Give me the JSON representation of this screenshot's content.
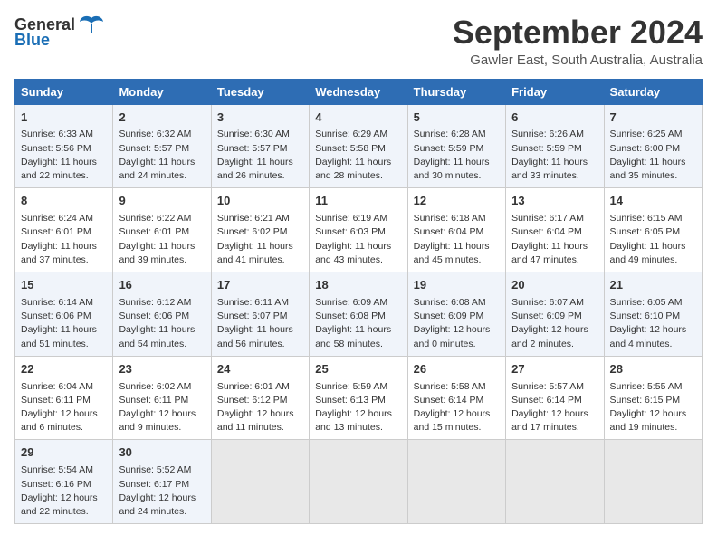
{
  "header": {
    "logo_general": "General",
    "logo_blue": "Blue",
    "title": "September 2024",
    "subtitle": "Gawler East, South Australia, Australia"
  },
  "days_of_week": [
    "Sunday",
    "Monday",
    "Tuesday",
    "Wednesday",
    "Thursday",
    "Friday",
    "Saturday"
  ],
  "weeks": [
    [
      {
        "day": "1",
        "sunrise": "6:33 AM",
        "sunset": "5:56 PM",
        "daylight": "11 hours and 22 minutes."
      },
      {
        "day": "2",
        "sunrise": "6:32 AM",
        "sunset": "5:57 PM",
        "daylight": "11 hours and 24 minutes."
      },
      {
        "day": "3",
        "sunrise": "6:30 AM",
        "sunset": "5:57 PM",
        "daylight": "11 hours and 26 minutes."
      },
      {
        "day": "4",
        "sunrise": "6:29 AM",
        "sunset": "5:58 PM",
        "daylight": "11 hours and 28 minutes."
      },
      {
        "day": "5",
        "sunrise": "6:28 AM",
        "sunset": "5:59 PM",
        "daylight": "11 hours and 30 minutes."
      },
      {
        "day": "6",
        "sunrise": "6:26 AM",
        "sunset": "5:59 PM",
        "daylight": "11 hours and 33 minutes."
      },
      {
        "day": "7",
        "sunrise": "6:25 AM",
        "sunset": "6:00 PM",
        "daylight": "11 hours and 35 minutes."
      }
    ],
    [
      {
        "day": "8",
        "sunrise": "6:24 AM",
        "sunset": "6:01 PM",
        "daylight": "11 hours and 37 minutes."
      },
      {
        "day": "9",
        "sunrise": "6:22 AM",
        "sunset": "6:01 PM",
        "daylight": "11 hours and 39 minutes."
      },
      {
        "day": "10",
        "sunrise": "6:21 AM",
        "sunset": "6:02 PM",
        "daylight": "11 hours and 41 minutes."
      },
      {
        "day": "11",
        "sunrise": "6:19 AM",
        "sunset": "6:03 PM",
        "daylight": "11 hours and 43 minutes."
      },
      {
        "day": "12",
        "sunrise": "6:18 AM",
        "sunset": "6:04 PM",
        "daylight": "11 hours and 45 minutes."
      },
      {
        "day": "13",
        "sunrise": "6:17 AM",
        "sunset": "6:04 PM",
        "daylight": "11 hours and 47 minutes."
      },
      {
        "day": "14",
        "sunrise": "6:15 AM",
        "sunset": "6:05 PM",
        "daylight": "11 hours and 49 minutes."
      }
    ],
    [
      {
        "day": "15",
        "sunrise": "6:14 AM",
        "sunset": "6:06 PM",
        "daylight": "11 hours and 51 minutes."
      },
      {
        "day": "16",
        "sunrise": "6:12 AM",
        "sunset": "6:06 PM",
        "daylight": "11 hours and 54 minutes."
      },
      {
        "day": "17",
        "sunrise": "6:11 AM",
        "sunset": "6:07 PM",
        "daylight": "11 hours and 56 minutes."
      },
      {
        "day": "18",
        "sunrise": "6:09 AM",
        "sunset": "6:08 PM",
        "daylight": "11 hours and 58 minutes."
      },
      {
        "day": "19",
        "sunrise": "6:08 AM",
        "sunset": "6:09 PM",
        "daylight": "12 hours and 0 minutes."
      },
      {
        "day": "20",
        "sunrise": "6:07 AM",
        "sunset": "6:09 PM",
        "daylight": "12 hours and 2 minutes."
      },
      {
        "day": "21",
        "sunrise": "6:05 AM",
        "sunset": "6:10 PM",
        "daylight": "12 hours and 4 minutes."
      }
    ],
    [
      {
        "day": "22",
        "sunrise": "6:04 AM",
        "sunset": "6:11 PM",
        "daylight": "12 hours and 6 minutes."
      },
      {
        "day": "23",
        "sunrise": "6:02 AM",
        "sunset": "6:11 PM",
        "daylight": "12 hours and 9 minutes."
      },
      {
        "day": "24",
        "sunrise": "6:01 AM",
        "sunset": "6:12 PM",
        "daylight": "12 hours and 11 minutes."
      },
      {
        "day": "25",
        "sunrise": "5:59 AM",
        "sunset": "6:13 PM",
        "daylight": "12 hours and 13 minutes."
      },
      {
        "day": "26",
        "sunrise": "5:58 AM",
        "sunset": "6:14 PM",
        "daylight": "12 hours and 15 minutes."
      },
      {
        "day": "27",
        "sunrise": "5:57 AM",
        "sunset": "6:14 PM",
        "daylight": "12 hours and 17 minutes."
      },
      {
        "day": "28",
        "sunrise": "5:55 AM",
        "sunset": "6:15 PM",
        "daylight": "12 hours and 19 minutes."
      }
    ],
    [
      {
        "day": "29",
        "sunrise": "5:54 AM",
        "sunset": "6:16 PM",
        "daylight": "12 hours and 22 minutes."
      },
      {
        "day": "30",
        "sunrise": "5:52 AM",
        "sunset": "6:17 PM",
        "daylight": "12 hours and 24 minutes."
      },
      null,
      null,
      null,
      null,
      null
    ]
  ],
  "labels": {
    "sunrise": "Sunrise: ",
    "sunset": "Sunset: ",
    "daylight": "Daylight: "
  }
}
